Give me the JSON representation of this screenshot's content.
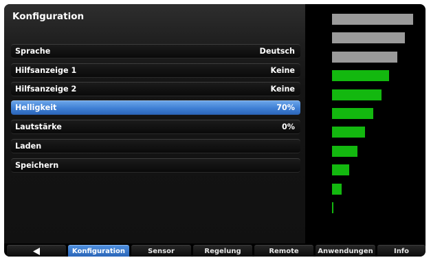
{
  "title": "Konfiguration",
  "menu": {
    "items": [
      {
        "label": "Sprache",
        "value": "Deutsch"
      },
      {
        "label": "Hilfsanzeige 1",
        "value": "Keine"
      },
      {
        "label": "Hilfsanzeige 2",
        "value": "Keine"
      },
      {
        "label": "Helligkeit",
        "value": "70%"
      },
      {
        "label": "Lautstärke",
        "value": "0%"
      },
      {
        "label": "Laden",
        "value": ""
      },
      {
        "label": "Speichern",
        "value": ""
      }
    ],
    "selected_index": 3
  },
  "brightness_scale": {
    "levels": 11,
    "active_levels": 8,
    "colors": {
      "inactive": "#9a9a9a",
      "active": "#13b80f"
    }
  },
  "tabs": [
    {
      "label": "",
      "icon": "back-arrow-icon"
    },
    {
      "label": "Konfiguration"
    },
    {
      "label": "Sensor"
    },
    {
      "label": "Regelung"
    },
    {
      "label": "Remote"
    },
    {
      "label": "Anwendungen"
    },
    {
      "label": "Info"
    }
  ],
  "active_tab": 1,
  "accent_color": "#3f7fd4"
}
